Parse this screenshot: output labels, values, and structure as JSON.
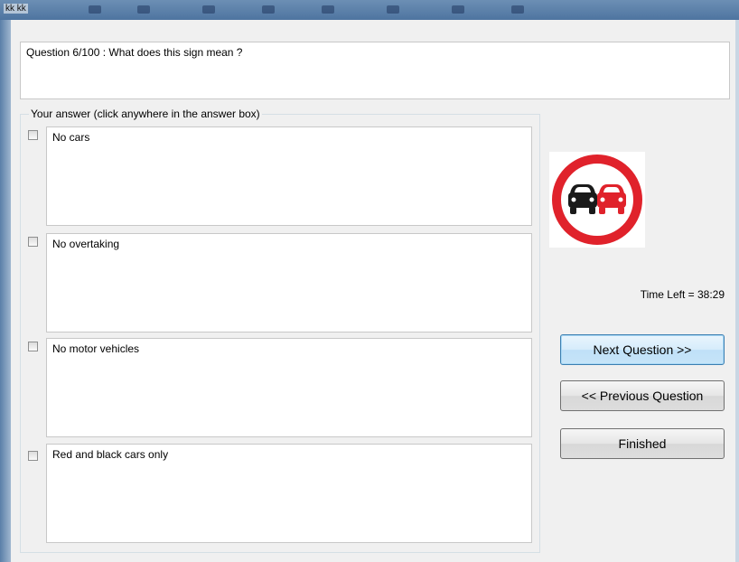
{
  "window": {
    "title": "kk kk"
  },
  "question": {
    "text": "Question 6/100 : What does this sign mean ?"
  },
  "answers": {
    "legend": "Your answer (click anywhere in the answer box)",
    "options": [
      {
        "label": "No cars",
        "checked": false
      },
      {
        "label": "No overtaking",
        "checked": false
      },
      {
        "label": "No motor vehicles",
        "checked": false
      },
      {
        "label": "Red and black cars only",
        "checked": false
      }
    ]
  },
  "sign": {
    "icon": "no-overtaking-sign-icon",
    "ring_color": "#e0222b",
    "left_car_color": "#1a1a1a",
    "right_car_color": "#e0222b"
  },
  "timer": {
    "text": "Time Left = 38:29"
  },
  "buttons": {
    "next": "Next Question >>",
    "previous": "<< Previous Question",
    "finished": "Finished"
  },
  "colors": {
    "focus_border": "#3c7fb1",
    "window_bg": "#f0f0f0"
  }
}
